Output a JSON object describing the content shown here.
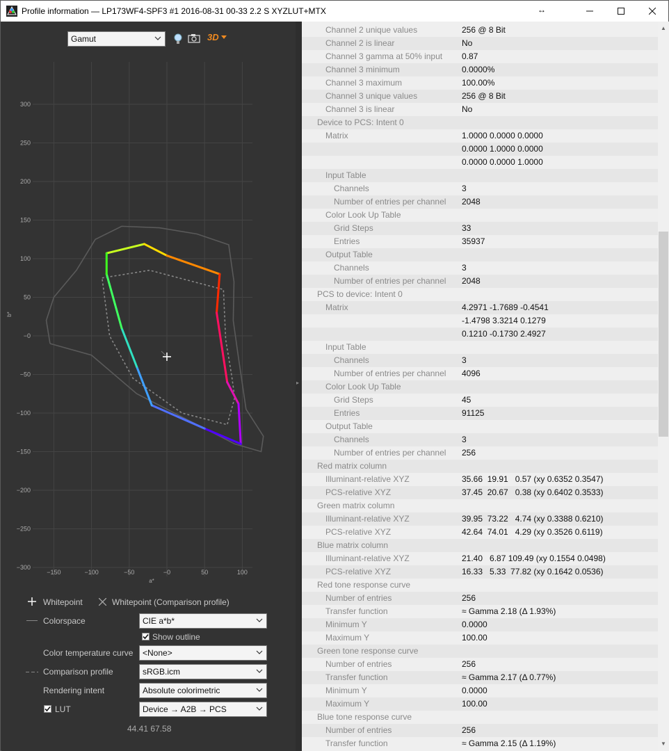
{
  "window": {
    "title": "Profile information — LP173WF4-SPF3 #1 2016-08-31 00-33 2.2 S XYZLUT+MTX",
    "controls": [
      "minimize",
      "maximize",
      "close"
    ]
  },
  "toolbar": {
    "view_select": "Gamut",
    "icons": [
      "lightbulb-icon",
      "camera-icon",
      "3d-icon"
    ],
    "three_d_label": "3D"
  },
  "chart_data": {
    "type": "scatter",
    "xlabel": "a*",
    "ylabel": "b*",
    "xlim": [
      -175,
      110
    ],
    "ylim": [
      -330,
      330
    ],
    "xticks": [
      "−150",
      "−100",
      "−50",
      "−0",
      "50",
      "100"
    ],
    "yticks": [
      "300",
      "250",
      "200",
      "150",
      "100",
      "50",
      "−0",
      "−50",
      "−100",
      "−150",
      "−200",
      "−250",
      "−300"
    ],
    "grid": true,
    "whitepoint": [
      0,
      -27
    ],
    "series": [
      {
        "role": "device gamut",
        "points": [
          [
            -80,
            107
          ],
          [
            -30,
            119
          ],
          [
            0,
            104
          ],
          [
            70,
            80
          ],
          [
            66,
            30
          ],
          [
            80,
            -60
          ],
          [
            95,
            -88
          ],
          [
            98,
            -140
          ],
          [
            50,
            -120
          ],
          [
            -20,
            -90
          ],
          [
            -40,
            -40
          ],
          [
            -60,
            10
          ],
          [
            -80,
            80
          ],
          [
            -80,
            107
          ]
        ]
      },
      {
        "role": "comparison profile sRGB",
        "dashed": true,
        "points": [
          [
            -86,
            75
          ],
          [
            -23,
            85
          ],
          [
            75,
            60
          ],
          [
            78,
            -5
          ],
          [
            86,
            -52
          ],
          [
            90,
            -80
          ],
          [
            80,
            -115
          ],
          [
            20,
            -100
          ],
          [
            -45,
            -55
          ],
          [
            -76,
            0
          ],
          [
            -86,
            75
          ]
        ]
      },
      {
        "role": "CIE a*b* outline",
        "points": [
          [
            -155,
            -10
          ],
          [
            -160,
            20
          ],
          [
            -150,
            50
          ],
          [
            -120,
            85
          ],
          [
            -95,
            125
          ],
          [
            -60,
            142
          ],
          [
            -10,
            140
          ],
          [
            40,
            132
          ],
          [
            82,
            118
          ],
          [
            89,
            70
          ],
          [
            88,
            20
          ],
          [
            94,
            -22
          ],
          [
            105,
            -95
          ],
          [
            128,
            -130
          ],
          [
            125,
            -150
          ],
          [
            90,
            -140
          ],
          [
            40,
            -115
          ],
          [
            -40,
            -75
          ],
          [
            -100,
            -25
          ],
          [
            -155,
            -10
          ]
        ]
      }
    ],
    "readout": "44.41 67.58"
  },
  "legend": {
    "whitepoint": "Whitepoint",
    "whitepoint_comparison": "Whitepoint (Comparison profile)",
    "colorspace_label": "Colorspace",
    "colorspace_value": "CIE a*b*",
    "show_outline": "Show outline",
    "color_temp_label": "Color temperature curve",
    "color_temp_value": "<None>",
    "comparison_label": "Comparison profile",
    "comparison_value": "sRGB.icm",
    "intent_label": "Rendering intent",
    "intent_value": "Absolute colorimetric",
    "lut_label": "LUT",
    "lut_value": "Device → A2B → PCS"
  },
  "info_rows": [
    {
      "k": "Channel 2 unique values",
      "v": "256 @ 8 Bit",
      "lvl": 1
    },
    {
      "k": "Channel 2 is linear",
      "v": "No",
      "lvl": 1
    },
    {
      "k": "Channel 3 gamma at 50% input",
      "v": "0.87",
      "lvl": 1
    },
    {
      "k": "Channel 3 minimum",
      "v": "0.0000%",
      "lvl": 1
    },
    {
      "k": "Channel 3 maximum",
      "v": "100.00%",
      "lvl": 1
    },
    {
      "k": "Channel 3 unique values",
      "v": "256 @ 8 Bit",
      "lvl": 1
    },
    {
      "k": "Channel 3 is linear",
      "v": "No",
      "lvl": 1
    },
    {
      "k": "Device to PCS: Intent 0",
      "v": "",
      "lvl": 0
    },
    {
      "k": "Matrix",
      "v": "1.0000 0.0000 0.0000",
      "lvl": 1
    },
    {
      "k": "",
      "v": "0.0000 1.0000 0.0000",
      "lvl": 1
    },
    {
      "k": "",
      "v": "0.0000 0.0000 1.0000",
      "lvl": 1
    },
    {
      "k": "Input Table",
      "v": "",
      "lvl": 1
    },
    {
      "k": "Channels",
      "v": "3",
      "lvl": 2
    },
    {
      "k": "Number of entries per channel",
      "v": "2048",
      "lvl": 2
    },
    {
      "k": "Color Look Up Table",
      "v": "",
      "lvl": 1
    },
    {
      "k": "Grid Steps",
      "v": "33",
      "lvl": 2
    },
    {
      "k": "Entries",
      "v": "35937",
      "lvl": 2
    },
    {
      "k": "Output Table",
      "v": "",
      "lvl": 1
    },
    {
      "k": "Channels",
      "v": "3",
      "lvl": 2
    },
    {
      "k": "Number of entries per channel",
      "v": "2048",
      "lvl": 2
    },
    {
      "k": "PCS to device: Intent 0",
      "v": "",
      "lvl": 0
    },
    {
      "k": "Matrix",
      "v": "4.2971 -1.7689 -0.4541",
      "lvl": 1
    },
    {
      "k": "",
      "v": "-1.4798 3.3214 0.1279",
      "lvl": 1
    },
    {
      "k": "",
      "v": "0.1210 -0.1730 2.4927",
      "lvl": 1
    },
    {
      "k": "Input Table",
      "v": "",
      "lvl": 1
    },
    {
      "k": "Channels",
      "v": "3",
      "lvl": 2
    },
    {
      "k": "Number of entries per channel",
      "v": "4096",
      "lvl": 2
    },
    {
      "k": "Color Look Up Table",
      "v": "",
      "lvl": 1
    },
    {
      "k": "Grid Steps",
      "v": "45",
      "lvl": 2
    },
    {
      "k": "Entries",
      "v": "91125",
      "lvl": 2
    },
    {
      "k": "Output Table",
      "v": "",
      "lvl": 1
    },
    {
      "k": "Channels",
      "v": "3",
      "lvl": 2
    },
    {
      "k": "Number of entries per channel",
      "v": "256",
      "lvl": 2
    },
    {
      "k": "Red matrix column",
      "v": "",
      "lvl": 0
    },
    {
      "k": "Illuminant-relative XYZ",
      "v": "35.66  19.91   0.57 (xy 0.6352 0.3547)",
      "lvl": 1
    },
    {
      "k": "PCS-relative XYZ",
      "v": "37.45  20.67   0.38 (xy 0.6402 0.3533)",
      "lvl": 1
    },
    {
      "k": "Green matrix column",
      "v": "",
      "lvl": 0
    },
    {
      "k": "Illuminant-relative XYZ",
      "v": "39.95  73.22   4.74 (xy 0.3388 0.6210)",
      "lvl": 1
    },
    {
      "k": "PCS-relative XYZ",
      "v": "42.64  74.01   4.29 (xy 0.3526 0.6119)",
      "lvl": 1
    },
    {
      "k": "Blue matrix column",
      "v": "",
      "lvl": 0
    },
    {
      "k": "Illuminant-relative XYZ",
      "v": "21.40   6.87 109.49 (xy 0.1554 0.0498)",
      "lvl": 1
    },
    {
      "k": "PCS-relative XYZ",
      "v": "16.33   5.33  77.82 (xy 0.1642 0.0536)",
      "lvl": 1
    },
    {
      "k": "Red tone response curve",
      "v": "",
      "lvl": 0
    },
    {
      "k": "Number of entries",
      "v": "256",
      "lvl": 1
    },
    {
      "k": "Transfer function",
      "v": "≈ Gamma 2.18 (Δ 1.93%)",
      "lvl": 1
    },
    {
      "k": "Minimum Y",
      "v": "0.0000",
      "lvl": 1
    },
    {
      "k": "Maximum Y",
      "v": "100.00",
      "lvl": 1
    },
    {
      "k": "Green tone response curve",
      "v": "",
      "lvl": 0
    },
    {
      "k": "Number of entries",
      "v": "256",
      "lvl": 1
    },
    {
      "k": "Transfer function",
      "v": "≈ Gamma 2.17 (Δ 0.77%)",
      "lvl": 1
    },
    {
      "k": "Minimum Y",
      "v": "0.0000",
      "lvl": 1
    },
    {
      "k": "Maximum Y",
      "v": "100.00",
      "lvl": 1
    },
    {
      "k": "Blue tone response curve",
      "v": "",
      "lvl": 0
    },
    {
      "k": "Number of entries",
      "v": "256",
      "lvl": 1
    },
    {
      "k": "Transfer function",
      "v": "≈ Gamma 2.15 (Δ 1.19%)",
      "lvl": 1
    }
  ]
}
